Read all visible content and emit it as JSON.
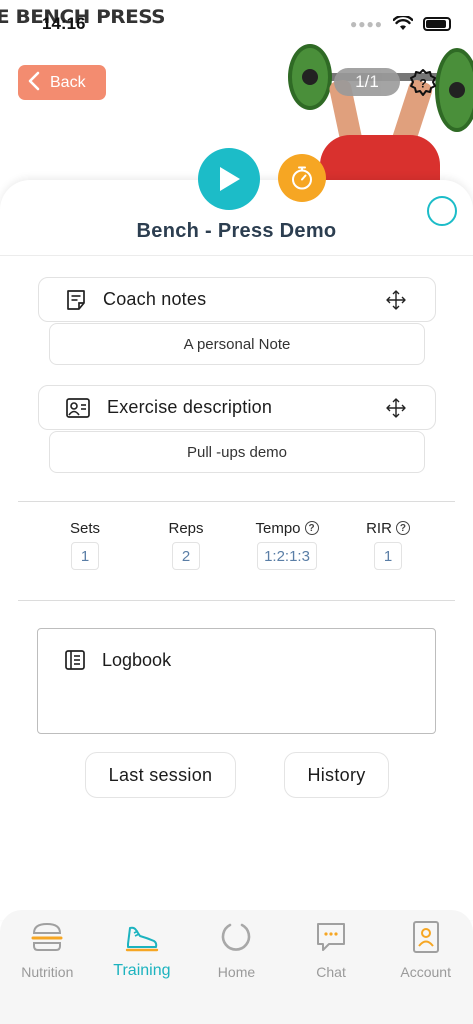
{
  "status_bar": {
    "time": "14:16"
  },
  "hero": {
    "video_title": "E BENCH PRESS",
    "back_label": "Back",
    "counter": "1/1"
  },
  "exercise": {
    "title": "Bench - Press Demo"
  },
  "coach_notes": {
    "label": "Coach notes",
    "text": "A personal Note"
  },
  "exercise_description": {
    "label": "Exercise description",
    "text": "Pull -ups demo"
  },
  "stats": [
    {
      "label": "Sets",
      "value": "1",
      "help": false
    },
    {
      "label": "Reps",
      "value": "2",
      "help": false
    },
    {
      "label": "Tempo",
      "value": "1:2:1:3",
      "help": true
    },
    {
      "label": "RIR",
      "value": "1",
      "help": true
    }
  ],
  "logbook": {
    "label": "Logbook"
  },
  "actions": {
    "last_session": "Last session",
    "history": "History"
  },
  "tabs": [
    {
      "label": "Nutrition",
      "icon": "burger-icon",
      "active": false
    },
    {
      "label": "Training",
      "icon": "shoe-icon",
      "active": true
    },
    {
      "label": "Home",
      "icon": "ring-icon",
      "active": false
    },
    {
      "label": "Chat",
      "icon": "chat-icon",
      "active": false
    },
    {
      "label": "Account",
      "icon": "account-icon",
      "active": false
    }
  ],
  "colors": {
    "accent": "#1cbcc8",
    "back": "#f38c70",
    "timer": "#f6a623",
    "tab_active": "#1cb3bf"
  }
}
